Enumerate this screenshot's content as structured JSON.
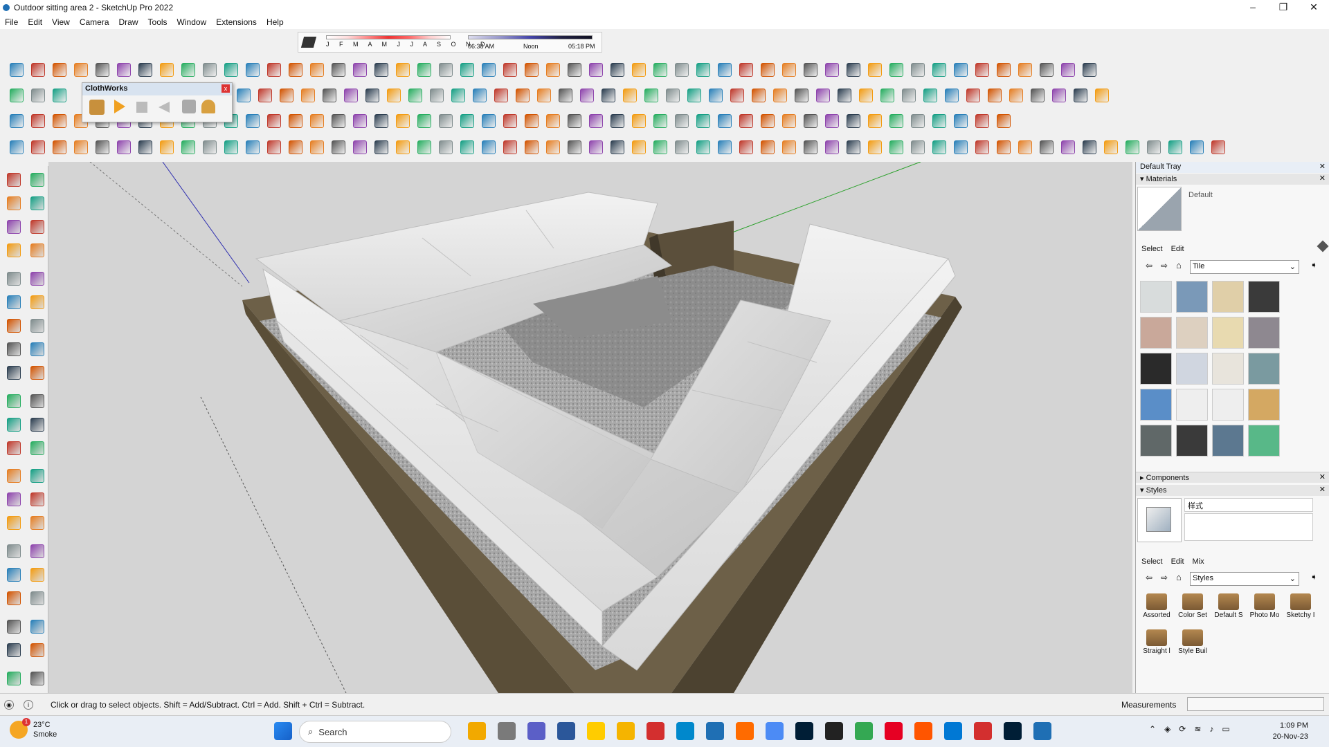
{
  "window": {
    "title": "Outdoor sitting area 2 - SketchUp Pro 2022",
    "controls": {
      "minimize": "–",
      "maximize": "❐",
      "close": "✕"
    }
  },
  "menu": [
    "File",
    "Edit",
    "View",
    "Camera",
    "Draw",
    "Tools",
    "Window",
    "Extensions",
    "Help"
  ],
  "shadows": {
    "months": "J F M A M J J A S O N D",
    "time_start": "06:38 AM",
    "time_noon": "Noon",
    "time_end": "05:18 PM"
  },
  "clothworks": {
    "title": "ClothWorks",
    "close": "x"
  },
  "status": {
    "message": "Click or drag to select objects. Shift = Add/Subtract. Ctrl = Add. Shift + Ctrl = Subtract.",
    "measurements_label": "Measurements"
  },
  "tray": {
    "title": "Default Tray",
    "materials": {
      "header": "Materials",
      "current": "Default",
      "tabs": [
        "Select",
        "Edit"
      ],
      "library": "Tile",
      "tile_colors": [
        "#d8dcdc",
        "#7a99b8",
        "#e0cfa8",
        "#3a3a3a",
        "#c9a89a",
        "#ddd0c0",
        "#e8dab0",
        "#8e8890",
        "#2a2a2a",
        "#d0d6e0",
        "#e8e4dc",
        "#7a9aa0",
        "#5a8ec8",
        "#eeeeee",
        "#eeeeee",
        "#d4a862",
        "#606868",
        "#3a3a3a",
        "#5c7890",
        "#58b888"
      ]
    },
    "components": {
      "header": "Components"
    },
    "styles": {
      "header": "Styles",
      "current": "样式",
      "tabs": [
        "Select",
        "Edit",
        "Mix"
      ],
      "library": "Styles",
      "items": [
        "Assorted",
        "Color Set",
        "Default S",
        "Photo Mo",
        "Sketchy I",
        "Straight l",
        "Style Buil"
      ]
    }
  },
  "taskbar": {
    "weather_temp": "23°C",
    "weather_desc": "Smoke",
    "weather_badge": "1",
    "search_placeholder": "Search",
    "time": "1:09 PM",
    "date": "20-Nov-23"
  }
}
